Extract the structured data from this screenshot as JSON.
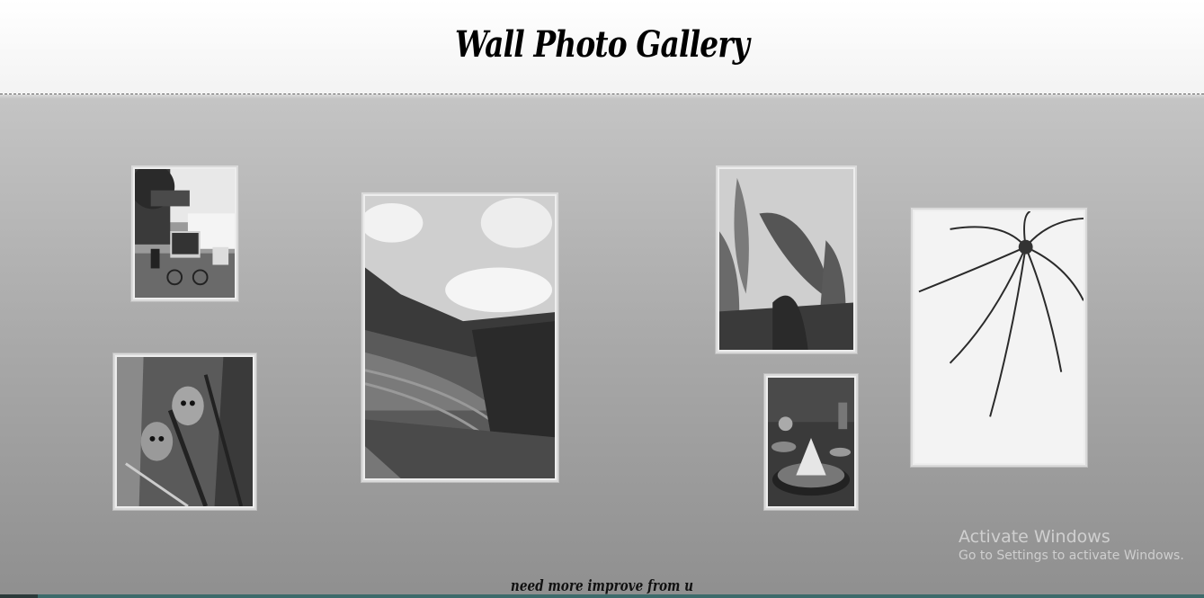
{
  "header": {
    "title": "Wall Photo Gallery"
  },
  "photos": [
    {
      "name": "photo-street-rickshaw",
      "subject": "street-rickshaw"
    },
    {
      "name": "photo-rice-terraces",
      "subject": "rice-terraces"
    },
    {
      "name": "photo-banana-leaves",
      "subject": "banana-leaves"
    },
    {
      "name": "photo-palm-tree",
      "subject": "palm-tree"
    },
    {
      "name": "photo-orangutans",
      "subject": "orangutans"
    },
    {
      "name": "photo-tumpeng-food",
      "subject": "tumpeng-food"
    }
  ],
  "footer": {
    "text": "need more improve from u"
  },
  "watermark": {
    "title": "Activate Windows",
    "subtitle": "Go to Settings to activate Windows."
  }
}
